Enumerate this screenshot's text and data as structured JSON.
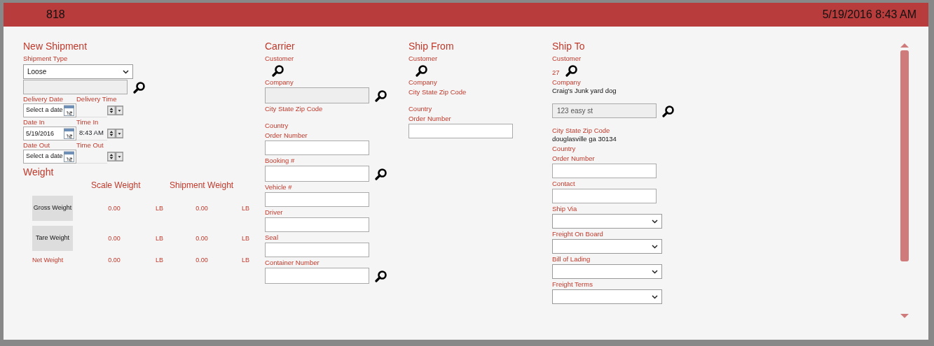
{
  "header": {
    "id": "818",
    "datetime": "5/19/2016 8:43 AM"
  },
  "new_shipment": {
    "title": "New Shipment",
    "shipment_type": {
      "label": "Shipment Type",
      "value": "Loose"
    },
    "date_rows": [
      {
        "date_label": "Delivery Date",
        "time_label": "Delivery Time",
        "date_placeholder": "Select a date"
      },
      {
        "date_label": "Date In",
        "time_label": "Time In",
        "date_value": "5/19/2016",
        "time_value": "8:43 AM"
      },
      {
        "date_label": "Date Out",
        "time_label": "Time Out",
        "date_placeholder": "Select a date"
      }
    ]
  },
  "weight": {
    "title": "Weight",
    "columns": [
      "Scale Weight",
      "Shipment Weight"
    ],
    "rows": [
      {
        "kind": "button",
        "label": "Gross Weight",
        "scale": "0.00",
        "scale_unit": "LB",
        "shipment": "0.00",
        "shipment_unit": "LB"
      },
      {
        "kind": "button",
        "label": "Tare Weight",
        "scale": "0.00",
        "scale_unit": "LB",
        "shipment": "0.00",
        "shipment_unit": "LB"
      },
      {
        "kind": "text",
        "label": "Net Weight",
        "scale": "0.00",
        "scale_unit": "LB",
        "shipment": "0.00",
        "shipment_unit": "LB"
      }
    ]
  },
  "sections": [
    {
      "title": "Carrier",
      "items": [
        {
          "kind": "lookup",
          "label": "Customer"
        },
        {
          "kind": "input",
          "label": "Company",
          "disabled": true,
          "search": true
        },
        {
          "kind": "label",
          "label": "City State Zip Code"
        },
        {
          "kind": "label",
          "label": "Country"
        },
        {
          "kind": "input",
          "label": "Order Number"
        },
        {
          "kind": "input",
          "label": "Booking #",
          "search": true
        },
        {
          "kind": "input",
          "label": "Vehicle #"
        },
        {
          "kind": "input",
          "label": "Driver"
        },
        {
          "kind": "input",
          "label": "Seal"
        },
        {
          "kind": "input",
          "label": "Container Number",
          "search": true
        }
      ]
    },
    {
      "title": "Ship From",
      "items": [
        {
          "kind": "lookup",
          "label": "Customer"
        },
        {
          "kind": "label",
          "label": "Company"
        },
        {
          "kind": "label",
          "label": "City State Zip Code"
        },
        {
          "kind": "label",
          "label": "Country"
        },
        {
          "kind": "input",
          "label": "Order Number"
        }
      ]
    },
    {
      "title": "Ship To",
      "items": [
        {
          "kind": "lookup",
          "label": "Customer",
          "value": "27"
        },
        {
          "kind": "label",
          "label": "Company",
          "value": "Craig's Junk yard dog"
        },
        {
          "kind": "input",
          "value": "123 easy st",
          "disabled": true,
          "search": true
        },
        {
          "kind": "label",
          "label": "City State Zip Code",
          "value": "douglasville ga 30134"
        },
        {
          "kind": "label",
          "label": "Country"
        },
        {
          "kind": "input",
          "label": "Order Number"
        },
        {
          "kind": "input",
          "label": "Contact"
        },
        {
          "kind": "select",
          "label": "Ship Via"
        },
        {
          "kind": "select",
          "label": "Freight On Board"
        },
        {
          "kind": "select",
          "label": "Bill of Lading"
        },
        {
          "kind": "select",
          "label": "Freight Terms"
        }
      ]
    }
  ]
}
